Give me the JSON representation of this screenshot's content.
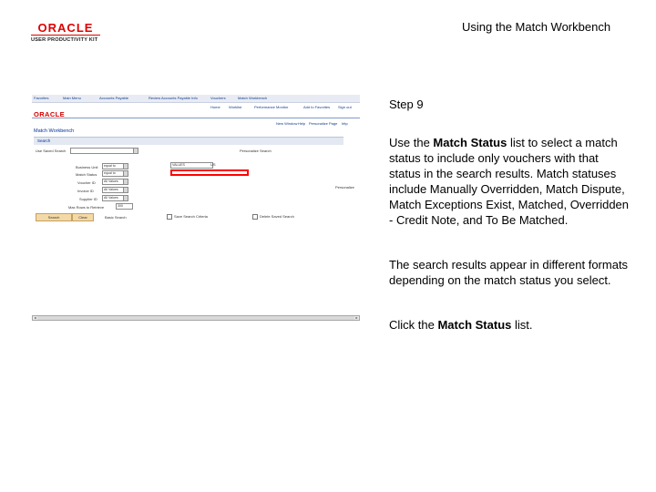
{
  "logo": {
    "brand": "ORACLE",
    "product": "USER PRODUCTIVITY KIT"
  },
  "doc_title": "Using the Match Workbench",
  "screenshot": {
    "tabs": [
      "Favorites",
      "Main Menu",
      "Accounts Payable",
      "Review Accounts Payable Info",
      "Vouchers",
      "Match Workbench"
    ],
    "oracle": "ORACLE",
    "menu": [
      "Home",
      "Worklist",
      "Performance Monitor",
      "Add to Favorites",
      "Sign out"
    ],
    "links": [
      "New Window",
      "Help",
      "Personalize Page",
      "http"
    ],
    "page_title": "Match Workbench",
    "search_label": "Search",
    "saved_search_label": "Use Saved Search",
    "fields": [
      {
        "label": "Business Unit",
        "value": "equal to"
      },
      {
        "label": "Match Status",
        "value": "equal to"
      },
      {
        "label": "Voucher ID",
        "value": "All Values"
      },
      {
        "label": "Invoice ID",
        "value": "All Values"
      },
      {
        "label": "Supplier ID",
        "value": "All Values"
      }
    ],
    "bu_value": "VALUES",
    "bu_suffix": "US",
    "delete_link": "Personalize Search",
    "max_rows_label": "Max Rows to Retrieve",
    "max_rows": "300",
    "next_link": "Personalize",
    "buttons": [
      "Search",
      "Clear"
    ],
    "basic_search": "Basic Search",
    "checkboxes": [
      "Save Search Criteria",
      "Delete Saved Search"
    ]
  },
  "step": "Step 9",
  "instructions": {
    "p1_a": "Use the ",
    "p1_b": "Match Status",
    "p1_c": " list to select a match status to include only vouchers with that status in the search results. Match statuses include Manually Overridden, Match Dispute, Match Exceptions Exist, Matched, Overridden - Credit Note, and To Be Matched.",
    "p2": "The search results appear in different formats depending on the match status you select.",
    "p3_a": "Click the ",
    "p3_b": "Match Status",
    "p3_c": " list."
  }
}
